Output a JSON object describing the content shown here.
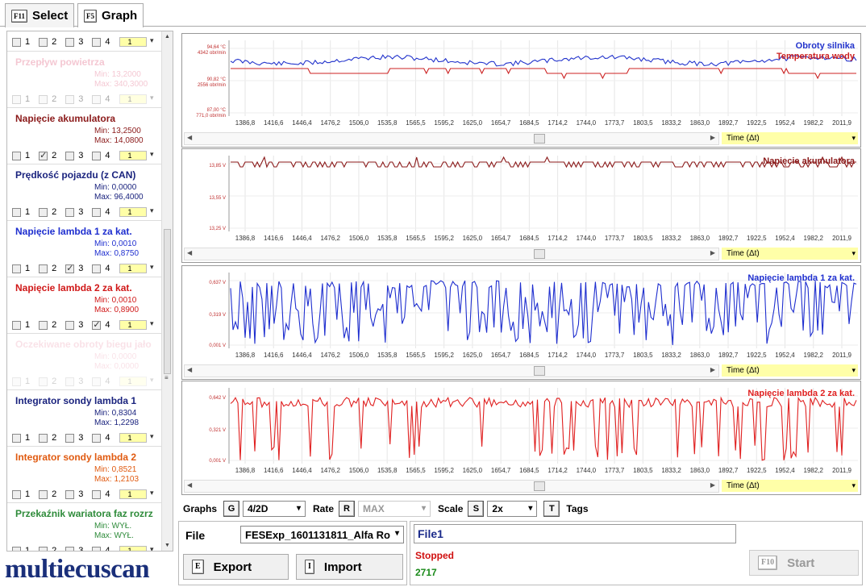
{
  "tabs": [
    {
      "key": "F11",
      "label": "Select"
    },
    {
      "key": "F5",
      "label": "Graph"
    }
  ],
  "sidebar": {
    "channels": [
      {
        "title": "",
        "min": "",
        "max": "",
        "color": "#888888",
        "checked": [],
        "faded": false,
        "top_only": true
      },
      {
        "title": "Przepływ powietrza",
        "min": "Min: 13,2000",
        "max": "Max: 340,3000",
        "color": "#e06080",
        "checked": [],
        "faded": true
      },
      {
        "title": "Napięcie akumulatora",
        "min": "Min: 13,2500",
        "max": "Max: 14,0800",
        "color": "#8b1a1a",
        "checked": [
          2
        ],
        "faded": false
      },
      {
        "title": "Prędkość pojazdu (z CAN)",
        "min": "Min: 0,0000",
        "max": "Max: 96,4000",
        "color": "#1a237e",
        "checked": [],
        "faded": false
      },
      {
        "title": "Napięcie lambda 1 za kat.",
        "min": "Min: 0,0010",
        "max": "Max: 0,8750",
        "color": "#1e2ecf",
        "checked": [
          3
        ],
        "faded": false
      },
      {
        "title": "Napięcie lambda 2 za kat.",
        "min": "Min: 0,0010",
        "max": "Max: 0,8900",
        "color": "#d01818",
        "checked": [
          4
        ],
        "faded": false
      },
      {
        "title": "Oczekiwane obroty biegu jało",
        "min": "Min: 0,0000",
        "max": "Max: 0,0000",
        "color": "#e06080",
        "checked": [],
        "faded2": true
      },
      {
        "title": "Integrator sondy lambda 1",
        "min": "Min: 0,8304",
        "max": "Max: 1,2298",
        "color": "#1a237e",
        "checked": [],
        "faded": false
      },
      {
        "title": "Integrator sondy lambda 2",
        "min": "Min: 0,8521",
        "max": "Max: 1,2103",
        "color": "#e05a10",
        "checked": [],
        "faded": false
      },
      {
        "title": "Przekaźnik wariatora faz rozrz",
        "min": "Min: WYŁ.",
        "max": "Max: WYŁ.",
        "color": "#2e8b3a",
        "checked": [],
        "faded": false
      }
    ],
    "checkbox_labels": [
      "1",
      "2",
      "3",
      "4"
    ],
    "dropdown_value": "1"
  },
  "logo": "multiecuscan",
  "panels": [
    {
      "legends": [
        {
          "text": "Obroty silnika",
          "color": "#2233cc"
        },
        {
          "text": "Temperatura wody",
          "color": "#cc2222"
        }
      ],
      "ylabels": [
        {
          "lines": [
            "94,64 °C",
            "4342 obr/min"
          ]
        },
        {
          "lines": [
            "90,82 °C",
            "2556 obr/min"
          ]
        },
        {
          "lines": [
            "87,00 °C",
            "771,0 obr/min"
          ]
        }
      ],
      "time_label": "Time (Δt)"
    },
    {
      "legends": [
        {
          "text": "Napięcie akumulatora",
          "color": "#8b1a1a"
        }
      ],
      "ylabels": [
        {
          "lines": [
            "13,85 V"
          ]
        },
        {
          "lines": [
            "13,55 V"
          ]
        },
        {
          "lines": [
            "13,25 V"
          ]
        }
      ],
      "time_label": "Time (Δt)"
    },
    {
      "legends": [
        {
          "text": "Napięcie lambda 1 za kat.",
          "color": "#1e2ecf"
        }
      ],
      "ylabels": [
        {
          "lines": [
            "0,637 V"
          ]
        },
        {
          "lines": [
            "0,319 V"
          ]
        },
        {
          "lines": [
            "0,001 V"
          ]
        }
      ],
      "time_label": "Time (Δt)"
    },
    {
      "legends": [
        {
          "text": "Napięcie lambda 2 za kat.",
          "color": "#e02020"
        }
      ],
      "ylabels": [
        {
          "lines": [
            "0,642 V"
          ]
        },
        {
          "lines": [
            "0,321 V"
          ]
        },
        {
          "lines": [
            "0,001 V"
          ]
        }
      ],
      "time_label": "Time (Δt)"
    }
  ],
  "xticks": [
    "1386,8",
    "1416,6",
    "1446,4",
    "1476,2",
    "1506,0",
    "1535,8",
    "1565,5",
    "1595,2",
    "1625,0",
    "1654,7",
    "1684,5",
    "1714,2",
    "1744,0",
    "1773,7",
    "1803,5",
    "1833,2",
    "1863,0",
    "1892,7",
    "1922,5",
    "1952,4",
    "1982,2",
    "2011,9"
  ],
  "toolbar": {
    "graphs_label": "Graphs",
    "graphs_key": "G",
    "graphs_value": "4/2D",
    "rate_label": "Rate",
    "rate_key": "R",
    "rate_value": "MAX",
    "scale_label": "Scale",
    "scale_key": "S",
    "scale_value": "2x",
    "tags_key": "T",
    "tags_label": "Tags"
  },
  "file": {
    "label": "File",
    "selected": "FESExp_1601131811_Alfa Ro",
    "export_key": "E",
    "export_label": "Export",
    "import_key": "I",
    "import_label": "Import"
  },
  "status": {
    "filename": "File1",
    "state": "Stopped",
    "count": "2717",
    "start_key": "F10",
    "start_label": "Start"
  }
}
